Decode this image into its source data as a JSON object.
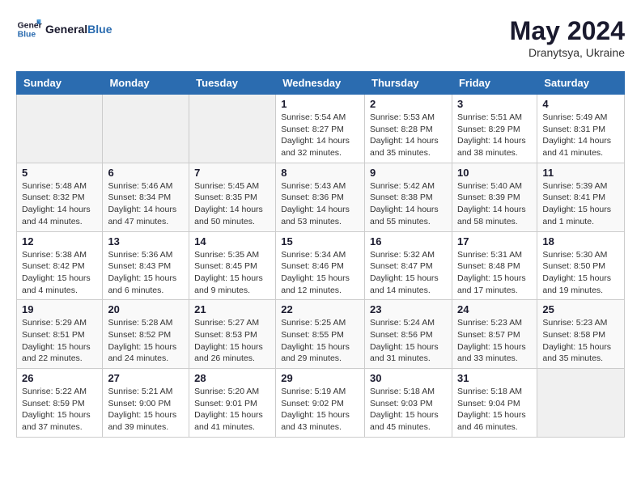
{
  "logo": {
    "line1": "General",
    "line2": "Blue"
  },
  "title": "May 2024",
  "location": "Dranytsya, Ukraine",
  "days_header": [
    "Sunday",
    "Monday",
    "Tuesday",
    "Wednesday",
    "Thursday",
    "Friday",
    "Saturday"
  ],
  "weeks": [
    [
      {
        "day": "",
        "sunrise": "",
        "sunset": "",
        "daylight": ""
      },
      {
        "day": "",
        "sunrise": "",
        "sunset": "",
        "daylight": ""
      },
      {
        "day": "",
        "sunrise": "",
        "sunset": "",
        "daylight": ""
      },
      {
        "day": "1",
        "sunrise": "Sunrise: 5:54 AM",
        "sunset": "Sunset: 8:27 PM",
        "daylight": "Daylight: 14 hours and 32 minutes."
      },
      {
        "day": "2",
        "sunrise": "Sunrise: 5:53 AM",
        "sunset": "Sunset: 8:28 PM",
        "daylight": "Daylight: 14 hours and 35 minutes."
      },
      {
        "day": "3",
        "sunrise": "Sunrise: 5:51 AM",
        "sunset": "Sunset: 8:29 PM",
        "daylight": "Daylight: 14 hours and 38 minutes."
      },
      {
        "day": "4",
        "sunrise": "Sunrise: 5:49 AM",
        "sunset": "Sunset: 8:31 PM",
        "daylight": "Daylight: 14 hours and 41 minutes."
      }
    ],
    [
      {
        "day": "5",
        "sunrise": "Sunrise: 5:48 AM",
        "sunset": "Sunset: 8:32 PM",
        "daylight": "Daylight: 14 hours and 44 minutes."
      },
      {
        "day": "6",
        "sunrise": "Sunrise: 5:46 AM",
        "sunset": "Sunset: 8:34 PM",
        "daylight": "Daylight: 14 hours and 47 minutes."
      },
      {
        "day": "7",
        "sunrise": "Sunrise: 5:45 AM",
        "sunset": "Sunset: 8:35 PM",
        "daylight": "Daylight: 14 hours and 50 minutes."
      },
      {
        "day": "8",
        "sunrise": "Sunrise: 5:43 AM",
        "sunset": "Sunset: 8:36 PM",
        "daylight": "Daylight: 14 hours and 53 minutes."
      },
      {
        "day": "9",
        "sunrise": "Sunrise: 5:42 AM",
        "sunset": "Sunset: 8:38 PM",
        "daylight": "Daylight: 14 hours and 55 minutes."
      },
      {
        "day": "10",
        "sunrise": "Sunrise: 5:40 AM",
        "sunset": "Sunset: 8:39 PM",
        "daylight": "Daylight: 14 hours and 58 minutes."
      },
      {
        "day": "11",
        "sunrise": "Sunrise: 5:39 AM",
        "sunset": "Sunset: 8:41 PM",
        "daylight": "Daylight: 15 hours and 1 minute."
      }
    ],
    [
      {
        "day": "12",
        "sunrise": "Sunrise: 5:38 AM",
        "sunset": "Sunset: 8:42 PM",
        "daylight": "Daylight: 15 hours and 4 minutes."
      },
      {
        "day": "13",
        "sunrise": "Sunrise: 5:36 AM",
        "sunset": "Sunset: 8:43 PM",
        "daylight": "Daylight: 15 hours and 6 minutes."
      },
      {
        "day": "14",
        "sunrise": "Sunrise: 5:35 AM",
        "sunset": "Sunset: 8:45 PM",
        "daylight": "Daylight: 15 hours and 9 minutes."
      },
      {
        "day": "15",
        "sunrise": "Sunrise: 5:34 AM",
        "sunset": "Sunset: 8:46 PM",
        "daylight": "Daylight: 15 hours and 12 minutes."
      },
      {
        "day": "16",
        "sunrise": "Sunrise: 5:32 AM",
        "sunset": "Sunset: 8:47 PM",
        "daylight": "Daylight: 15 hours and 14 minutes."
      },
      {
        "day": "17",
        "sunrise": "Sunrise: 5:31 AM",
        "sunset": "Sunset: 8:48 PM",
        "daylight": "Daylight: 15 hours and 17 minutes."
      },
      {
        "day": "18",
        "sunrise": "Sunrise: 5:30 AM",
        "sunset": "Sunset: 8:50 PM",
        "daylight": "Daylight: 15 hours and 19 minutes."
      }
    ],
    [
      {
        "day": "19",
        "sunrise": "Sunrise: 5:29 AM",
        "sunset": "Sunset: 8:51 PM",
        "daylight": "Daylight: 15 hours and 22 minutes."
      },
      {
        "day": "20",
        "sunrise": "Sunrise: 5:28 AM",
        "sunset": "Sunset: 8:52 PM",
        "daylight": "Daylight: 15 hours and 24 minutes."
      },
      {
        "day": "21",
        "sunrise": "Sunrise: 5:27 AM",
        "sunset": "Sunset: 8:53 PM",
        "daylight": "Daylight: 15 hours and 26 minutes."
      },
      {
        "day": "22",
        "sunrise": "Sunrise: 5:25 AM",
        "sunset": "Sunset: 8:55 PM",
        "daylight": "Daylight: 15 hours and 29 minutes."
      },
      {
        "day": "23",
        "sunrise": "Sunrise: 5:24 AM",
        "sunset": "Sunset: 8:56 PM",
        "daylight": "Daylight: 15 hours and 31 minutes."
      },
      {
        "day": "24",
        "sunrise": "Sunrise: 5:23 AM",
        "sunset": "Sunset: 8:57 PM",
        "daylight": "Daylight: 15 hours and 33 minutes."
      },
      {
        "day": "25",
        "sunrise": "Sunrise: 5:23 AM",
        "sunset": "Sunset: 8:58 PM",
        "daylight": "Daylight: 15 hours and 35 minutes."
      }
    ],
    [
      {
        "day": "26",
        "sunrise": "Sunrise: 5:22 AM",
        "sunset": "Sunset: 8:59 PM",
        "daylight": "Daylight: 15 hours and 37 minutes."
      },
      {
        "day": "27",
        "sunrise": "Sunrise: 5:21 AM",
        "sunset": "Sunset: 9:00 PM",
        "daylight": "Daylight: 15 hours and 39 minutes."
      },
      {
        "day": "28",
        "sunrise": "Sunrise: 5:20 AM",
        "sunset": "Sunset: 9:01 PM",
        "daylight": "Daylight: 15 hours and 41 minutes."
      },
      {
        "day": "29",
        "sunrise": "Sunrise: 5:19 AM",
        "sunset": "Sunset: 9:02 PM",
        "daylight": "Daylight: 15 hours and 43 minutes."
      },
      {
        "day": "30",
        "sunrise": "Sunrise: 5:18 AM",
        "sunset": "Sunset: 9:03 PM",
        "daylight": "Daylight: 15 hours and 45 minutes."
      },
      {
        "day": "31",
        "sunrise": "Sunrise: 5:18 AM",
        "sunset": "Sunset: 9:04 PM",
        "daylight": "Daylight: 15 hours and 46 minutes."
      },
      {
        "day": "",
        "sunrise": "",
        "sunset": "",
        "daylight": ""
      }
    ]
  ]
}
